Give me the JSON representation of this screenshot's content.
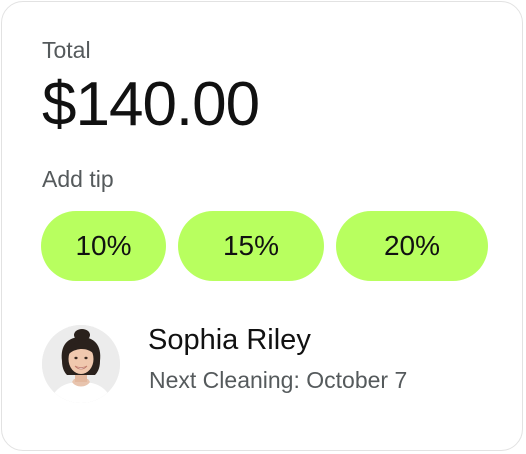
{
  "total": {
    "label": "Total",
    "amount": "$140.00"
  },
  "tip": {
    "label": "Add tip",
    "options": [
      "10%",
      "15%",
      "20%"
    ],
    "accent_color": "#b8ff5f"
  },
  "cleaner": {
    "name": "Sophia Riley",
    "next_cleaning": "Next Cleaning: October 7"
  }
}
